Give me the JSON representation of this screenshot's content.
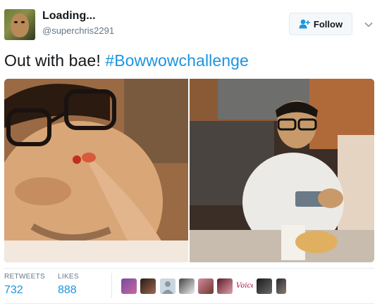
{
  "user": {
    "display_name": "Loading...",
    "handle": "@superchris2291",
    "avatar_icon": "user-avatar"
  },
  "follow": {
    "label": "Follow",
    "icon": "add-user-icon",
    "icon_color": "#1b95e0"
  },
  "menu": {
    "icon": "chevron-down-icon"
  },
  "tweet": {
    "text": "Out with bae! ",
    "hashtag": "#Bowwowchallenge",
    "hashtag_color": "#1b95e0"
  },
  "media": [
    {
      "name": "photo-closeup-selfie"
    },
    {
      "name": "photo-restaurant-table"
    }
  ],
  "stats": {
    "retweets_label": "RETWEETS",
    "retweets_value": "732",
    "likes_label": "LIKES",
    "likes_value": "888"
  },
  "likers": {
    "text_avatar_label": "Voices",
    "count_shown": 9
  }
}
